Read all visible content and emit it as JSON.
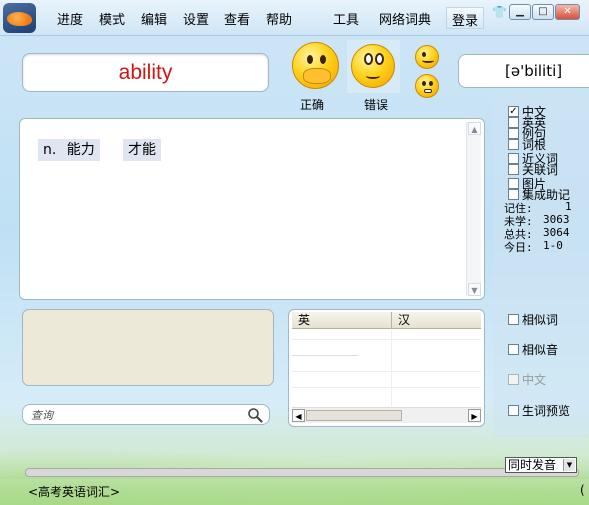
{
  "menu": {
    "items": [
      "进度",
      "模式",
      "编辑",
      "设置",
      "查看",
      "帮助"
    ],
    "tools": "工具",
    "dictionary": "网络词典",
    "login": "登录"
  },
  "window_controls": {
    "shirt_icon": "shirt-icon",
    "minimize": "▁",
    "maximize": "□",
    "close": "✕"
  },
  "word": {
    "text": "ability",
    "phonetic": "[ə'biliti]",
    "color": "#d21414"
  },
  "feedback": {
    "correct_label": "正确",
    "wrong_label": "错误"
  },
  "meaning": {
    "pos": "n.",
    "senses": [
      "能力",
      "才能"
    ]
  },
  "display_options": [
    {
      "label": "中文",
      "checked": true
    },
    {
      "label": "英英",
      "checked": false
    },
    {
      "label": "例句",
      "checked": false
    },
    {
      "label": "词根",
      "checked": false
    },
    {
      "label": "近义词",
      "checked": false
    },
    {
      "label": "关联词",
      "checked": false
    },
    {
      "label": "图片",
      "checked": false
    },
    {
      "label": "集成助记",
      "checked": false
    }
  ],
  "stats": [
    {
      "label": "记住:",
      "value": "1"
    },
    {
      "label": "未学:",
      "value": "3063"
    },
    {
      "label": "总共:",
      "value": "3064"
    },
    {
      "label": "今日:",
      "value": "1-0"
    }
  ],
  "lower_options": [
    {
      "label": "相似词",
      "checked": false,
      "disabled": false
    },
    {
      "label": "相似音",
      "checked": false,
      "disabled": false
    },
    {
      "label": "中文",
      "checked": false,
      "disabled": true
    },
    {
      "label": "生词预览",
      "checked": false,
      "disabled": false
    }
  ],
  "table": {
    "col_en": "英",
    "col_zh": "汉"
  },
  "search": {
    "placeholder": "查询"
  },
  "bottom": {
    "sync_select": "同时发音",
    "vocab_label": "<高考英语词汇>",
    "status_right": "("
  }
}
